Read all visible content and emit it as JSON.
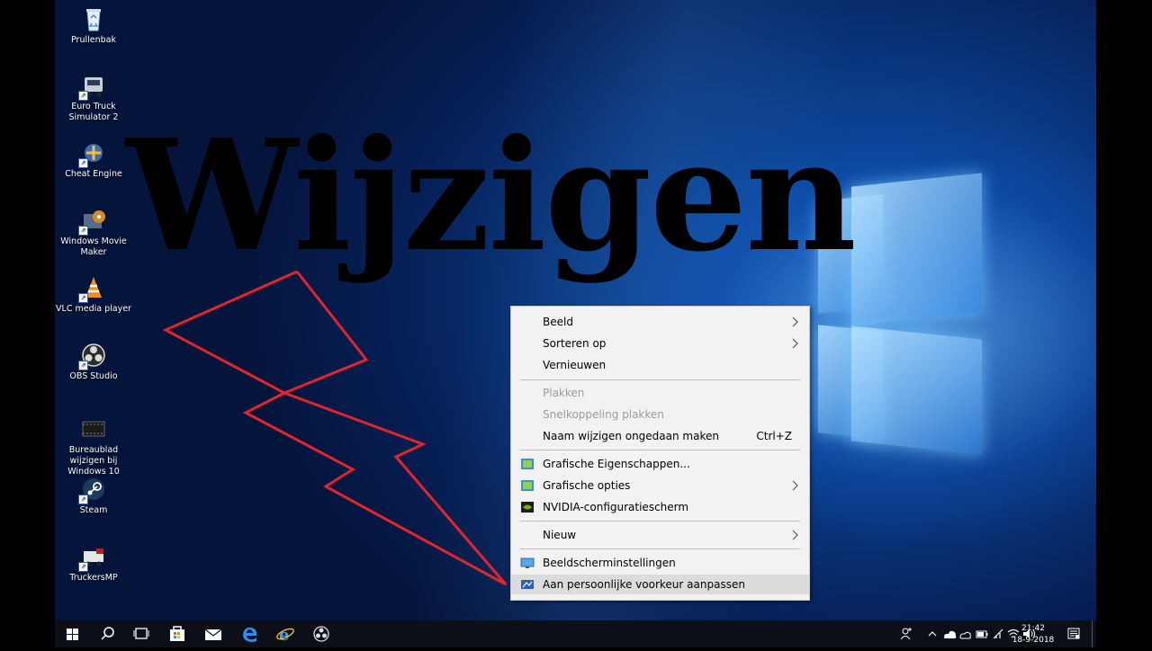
{
  "overlay_title": "Wijzigen",
  "desktop_icons": [
    {
      "label": "Prullenbak",
      "icon": "recycle-bin-icon"
    },
    {
      "label": "Euro Truck Simulator 2",
      "icon": "truck-icon"
    },
    {
      "label": "Cheat Engine",
      "icon": "cheat-engine-icon"
    },
    {
      "label": "Windows Movie Maker",
      "icon": "film-reel-icon"
    },
    {
      "label": "VLC media player",
      "icon": "vlc-cone-icon"
    },
    {
      "label": "OBS Studio",
      "icon": "obs-icon"
    },
    {
      "label": "Bureaublad wijzigen bij Windows 10",
      "icon": "video-file-icon"
    },
    {
      "label": "Steam",
      "icon": "steam-icon"
    },
    {
      "label": "TruckersMP",
      "icon": "truckersmp-icon"
    }
  ],
  "context_menu": {
    "items": [
      {
        "label": "Beeld",
        "submenu": true
      },
      {
        "label": "Sorteren op",
        "submenu": true
      },
      {
        "label": "Vernieuwen"
      },
      {
        "label": "Plakken",
        "disabled": true
      },
      {
        "label": "Snelkoppeling plakken",
        "disabled": true
      },
      {
        "label": "Naam wijzigen ongedaan maken",
        "shortcut": "Ctrl+Z"
      },
      {
        "label": "Grafische Eigenschappen...",
        "icon": "intel-graphics-icon"
      },
      {
        "label": "Grafische opties",
        "icon": "intel-graphics-icon",
        "submenu": true
      },
      {
        "label": "NVIDIA-configuratiescherm",
        "icon": "nvidia-icon"
      },
      {
        "label": "Nieuw",
        "submenu": true
      },
      {
        "label": "Beeldscherminstellingen",
        "icon": "display-icon"
      },
      {
        "label": "Aan persoonlijke voorkeur aanpassen",
        "icon": "personalize-icon",
        "highlighted": true
      }
    ]
  },
  "taskbar": {
    "pinned": [
      "start-icon",
      "search-icon",
      "task-view-icon",
      "store-icon",
      "mail-icon",
      "edge-icon",
      "internet-explorer-icon",
      "obs-icon"
    ],
    "tray_icons": [
      "people-icon",
      "chevron-up-icon",
      "onedrive-icon",
      "cloud-icon",
      "battery-icon",
      "network-icon",
      "wifi-icon",
      "volume-icon",
      "action-center-icon"
    ],
    "time": "21:42",
    "date": "18-9-2018"
  },
  "colors": {
    "bolt": "#e0252b",
    "menu_bg": "#f2f2f2",
    "taskbar_bg": "#0c0f18"
  }
}
